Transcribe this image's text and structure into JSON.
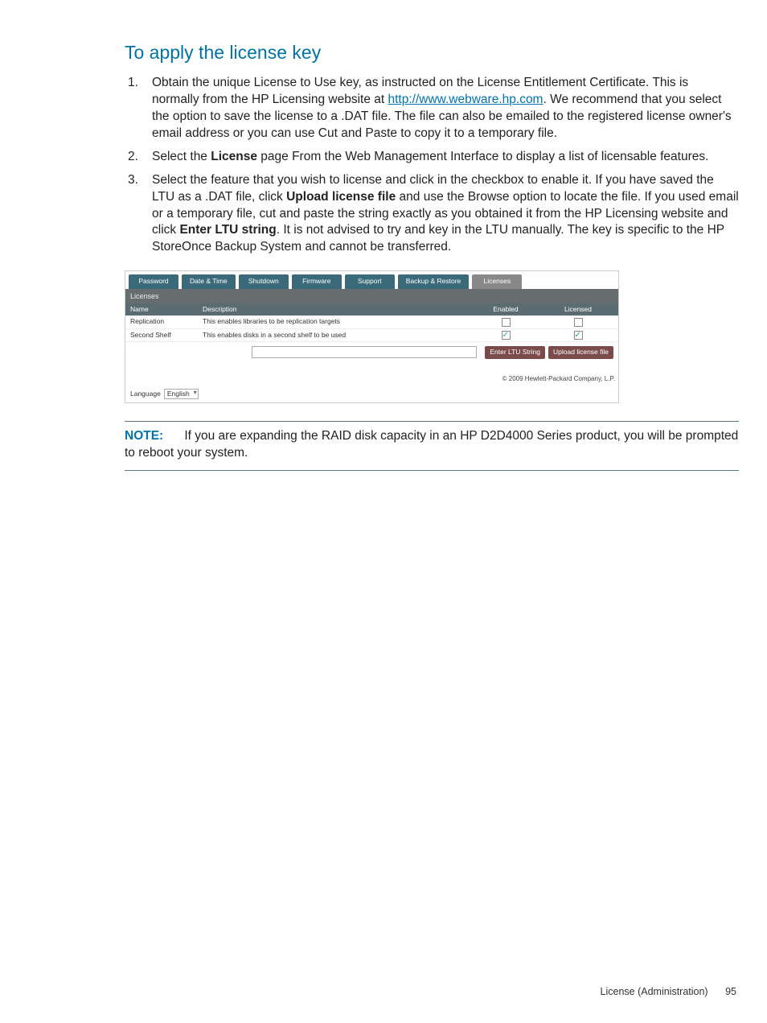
{
  "heading": "To apply the license key",
  "steps": {
    "s1a": "Obtain the unique License to Use key, as instructed on the License Entitlement Certificate. This is normally from the HP Licensing website at ",
    "s1_link": "http://www.webware.hp.com",
    "s1b": ". We recommend that you select the option to save the license to a .DAT file. The file can also be emailed to the registered license owner's email address or you can use Cut and Paste to copy it to a temporary file.",
    "s2a": "Select the ",
    "s2_bold": "License",
    "s2b": " page From the Web Management Interface to display a list of licensable features.",
    "s3a": "Select the feature that you wish to license and click in the checkbox to enable it. If you have saved the LTU as a .DAT file, click ",
    "s3_bold1": "Upload license file",
    "s3b": " and use the Browse option to locate the file. If you used email or a temporary file, cut and paste the string exactly as you obtained it from the HP Licensing website and click ",
    "s3_bold2": "Enter LTU string",
    "s3c": ". It is not advised to try and key in the LTU manually. The key is specific to the HP StoreOnce Backup System and cannot be transferred."
  },
  "tabs": [
    "Password",
    "Date & Time",
    "Shutdown",
    "Firmware",
    "Support",
    "Backup & Restore",
    "Licenses"
  ],
  "active_tab_index": 6,
  "subheader": "Licenses",
  "table": {
    "headers": [
      "Name",
      "Description",
      "Enabled",
      "Licensed"
    ],
    "rows": [
      {
        "name": "Replication",
        "desc": "This enables libraries to be replication targets",
        "enabled": false,
        "licensed": false
      },
      {
        "name": "Second Shelf",
        "desc": "This enables disks in a second shelf to be used",
        "enabled": true,
        "licensed": true
      }
    ]
  },
  "buttons": {
    "enter": "Enter LTU String",
    "upload": "Upload license file"
  },
  "copyright": "© 2009 Hewlett-Packard Company, L.P.",
  "lang_label": "Language",
  "lang_value": "English",
  "note_label": "NOTE:",
  "note_text": "If you are expanding the RAID disk capacity in an HP D2D4000 Series product, you will be prompted to reboot your system.",
  "footer_section": "License (Administration)",
  "footer_page": "95"
}
